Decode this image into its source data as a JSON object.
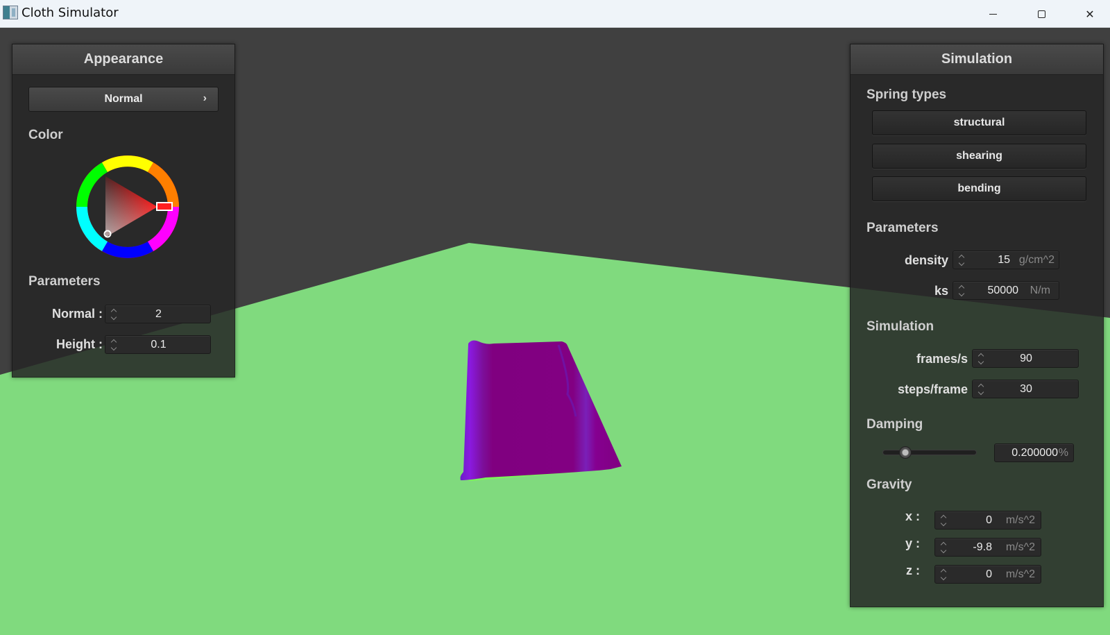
{
  "window": {
    "title": "Cloth Simulator"
  },
  "colors": {
    "background": "#404040",
    "ground": "#80da7e",
    "cloth": "#800080",
    "cloth_edge": "#7cf55a",
    "selected_color": "#ff0000"
  },
  "appearance": {
    "title": "Appearance",
    "mode_dropdown": "Normal",
    "color_label": "Color",
    "parameters_label": "Parameters",
    "params": [
      {
        "label": "Normal :",
        "value": "2"
      },
      {
        "label": "Height :",
        "value": "0.1"
      }
    ]
  },
  "simulation": {
    "title": "Simulation",
    "spring_types_label": "Spring types",
    "spring_buttons": [
      "structural",
      "shearing",
      "bending"
    ],
    "parameters_label": "Parameters",
    "density": {
      "label": "density :",
      "value": "15",
      "unit": "g/cm^2"
    },
    "ks": {
      "label": "ks :",
      "value": "50000",
      "unit": "N/m"
    },
    "simulation_label": "Simulation",
    "fps": {
      "label": "frames/s :",
      "value": "90"
    },
    "steps": {
      "label": "steps/frame :",
      "value": "30"
    },
    "damping_label": "Damping",
    "damping": {
      "value": "0.200000",
      "unit": "%",
      "slider_fraction": 0.2
    },
    "gravity_label": "Gravity",
    "gravity": [
      {
        "label": "x :",
        "value": "0",
        "unit": "m/s^2"
      },
      {
        "label": "y :",
        "value": "-9.8",
        "unit": "m/s^2"
      },
      {
        "label": "z :",
        "value": "0",
        "unit": "m/s^2"
      }
    ]
  }
}
